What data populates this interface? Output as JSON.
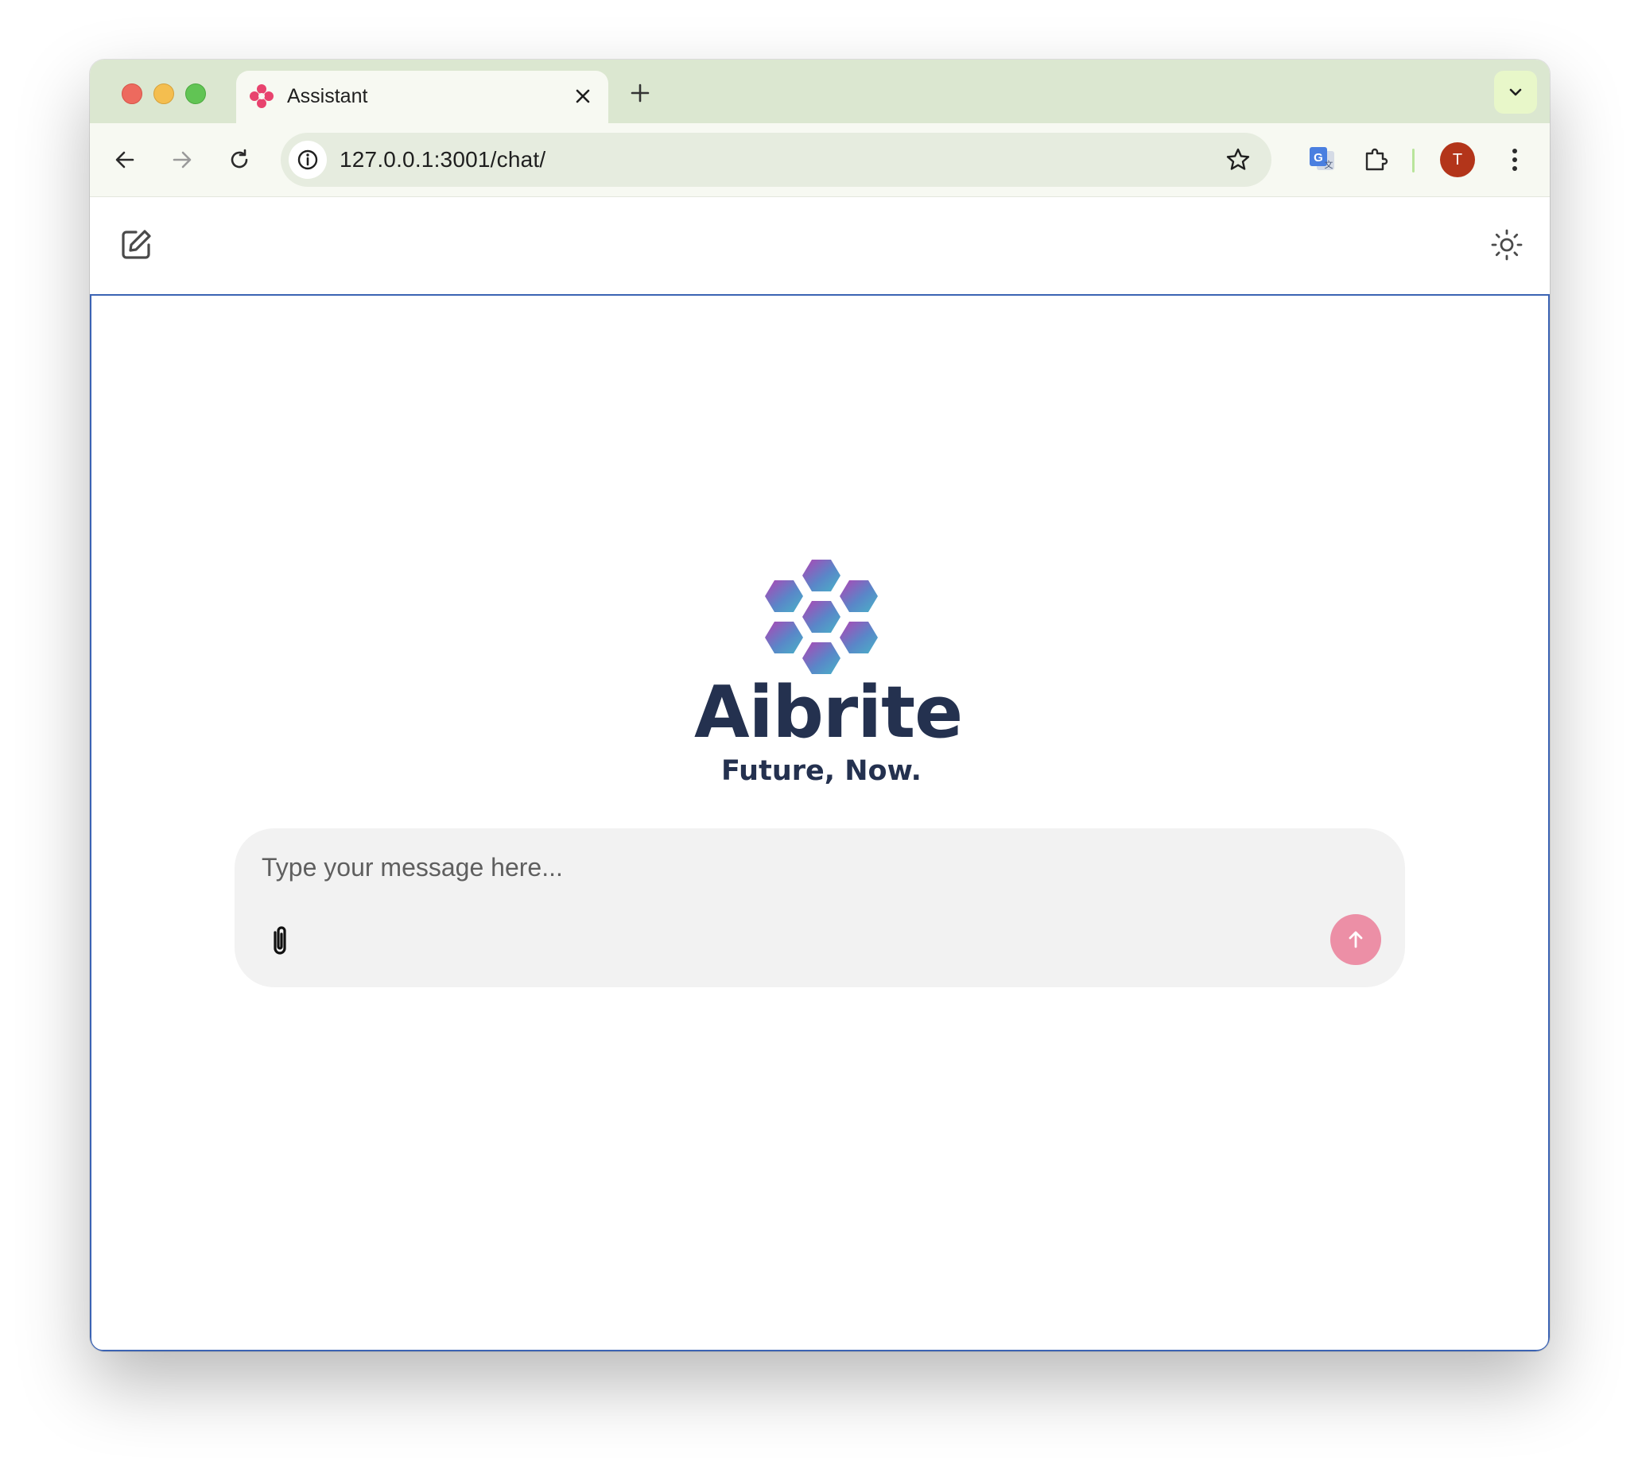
{
  "browser": {
    "tab_title": "Assistant",
    "url": "127.0.0.1:3001/chat/",
    "profile_initial": "T"
  },
  "app": {
    "brand_name": "Aibrite",
    "tagline": "Future, Now.",
    "composer": {
      "placeholder": "Type your message here..."
    }
  },
  "colors": {
    "tabstrip": "#dbe7d0",
    "toolbar": "#f7f9f2",
    "brand_text": "#24314f",
    "send_button": "#ec8fa6",
    "avatar": "#b3351a",
    "frame_border": "#3b63b3"
  },
  "icons": {
    "favicon": "pink-flower-icon",
    "new_chat": "edit-icon",
    "theme": "sun-icon",
    "attach": "paperclip-icon",
    "send": "arrow-up-icon"
  }
}
